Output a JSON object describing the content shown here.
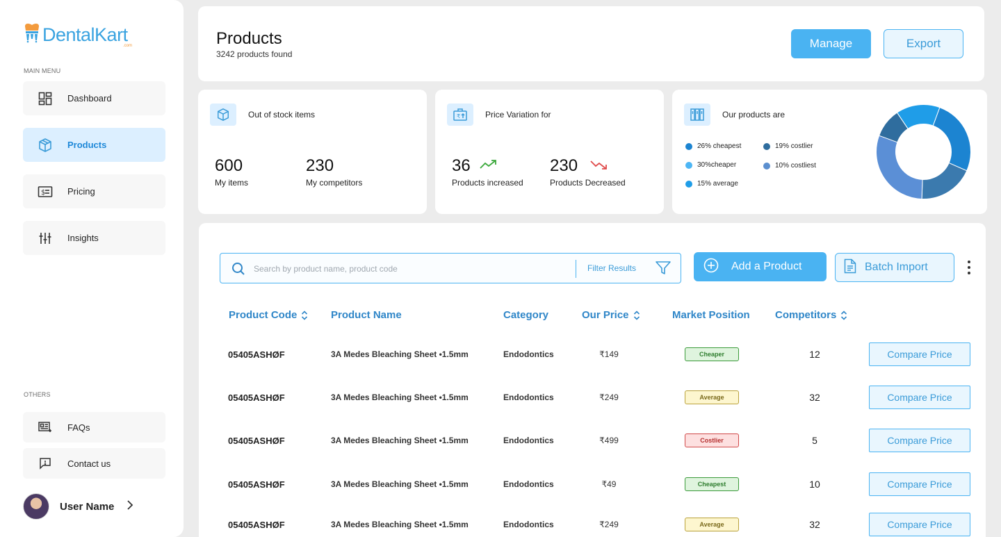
{
  "brand": {
    "name": "DentalKart",
    "sub": ".com"
  },
  "sidebar": {
    "main_menu_label": "MAIN MENU",
    "others_label": "OTHERS",
    "items": [
      {
        "label": "Dashboard",
        "icon": "dashboard-icon"
      },
      {
        "label": "Products",
        "icon": "cube-icon",
        "active": true
      },
      {
        "label": "Pricing",
        "icon": "price-tag-icon"
      },
      {
        "label": "Insights",
        "icon": "sliders-icon"
      }
    ],
    "others": [
      {
        "label": "FAQs",
        "icon": "faq-icon"
      },
      {
        "label": "Contact us",
        "icon": "chat-icon"
      }
    ],
    "user_name": "User Name"
  },
  "header": {
    "title": "Products",
    "subtitle": "3242 products found",
    "manage_label": "Manage",
    "export_label": "Export"
  },
  "stats": {
    "stock": {
      "title": "Out of stock items",
      "my_items_value": "600",
      "my_items_label": "My items",
      "competitors_value": "230",
      "competitors_label": "My competitors"
    },
    "variation": {
      "title": "Price Variation for",
      "increased_value": "36",
      "increased_label": "Products increased",
      "decreased_value": "230",
      "decreased_label": "Products Decreased"
    },
    "position": {
      "title": "Our products are",
      "legend": [
        {
          "label": "26% cheapest",
          "color": "#1c84d1"
        },
        {
          "label": "19% costlier",
          "color": "#2f6d9e"
        },
        {
          "label": "30%cheaper",
          "color": "#4db6f5"
        },
        {
          "label": "10% costliest",
          "color": "#5b8fcf"
        },
        {
          "label": "15% average",
          "color": "#1f9de8"
        }
      ]
    }
  },
  "chart_data": {
    "type": "pie",
    "title": "",
    "series": [
      {
        "name": "cheapest",
        "value": 26,
        "color": "#1c84d1"
      },
      {
        "name": "costlier",
        "value": 19,
        "color": "#3b7aae"
      },
      {
        "name": "cheaper",
        "value": 30,
        "color": "#5b8fd6"
      },
      {
        "name": "costliest",
        "value": 10,
        "color": "#2f6d9e"
      },
      {
        "name": "average",
        "value": 15,
        "color": "#1f9de8"
      }
    ]
  },
  "toolbar": {
    "search_placeholder": "Search by product name, product code",
    "filter_label": "Filter Results",
    "add_label": "Add a Product",
    "batch_label": "Batch Import"
  },
  "table": {
    "headers": {
      "code": "Product Code",
      "name": "Product Name",
      "category": "Category",
      "price": "Our Price",
      "position": "Market Position",
      "competitors": "Competitors"
    },
    "compare_label": "Compare Price",
    "rows": [
      {
        "code": "05405ASHØF",
        "name": "3A Medes Bleaching Sheet •1.5mm",
        "category": "Endodontics",
        "price": "₹149",
        "position": "Cheaper",
        "competitors": "12"
      },
      {
        "code": "05405ASHØF",
        "name": "3A Medes Bleaching Sheet •1.5mm",
        "category": "Endodontics",
        "price": "₹249",
        "position": "Average",
        "competitors": "32"
      },
      {
        "code": "05405ASHØF",
        "name": "3A Medes Bleaching Sheet •1.5mm",
        "category": "Endodontics",
        "price": "₹499",
        "position": "Costlier",
        "competitors": "5"
      },
      {
        "code": "05405ASHØF",
        "name": "3A Medes Bleaching Sheet •1.5mm",
        "category": "Endodontics",
        "price": "₹49",
        "position": "Cheapest",
        "competitors": "10"
      },
      {
        "code": "05405ASHØF",
        "name": "3A Medes Bleaching Sheet •1.5mm",
        "category": "Endodontics",
        "price": "₹249",
        "position": "Average",
        "competitors": "32"
      }
    ]
  },
  "badge_colors": {
    "Cheaper": {
      "bg": "#dff4de",
      "border": "#3a9a3a",
      "text": "#2e7d2e"
    },
    "Cheapest": {
      "bg": "#dff4de",
      "border": "#3a9a3a",
      "text": "#2e7d2e"
    },
    "Average": {
      "bg": "#fdf6cf",
      "border": "#b9a13a",
      "text": "#7a6a1c"
    },
    "Costlier": {
      "bg": "#fde0e0",
      "border": "#d04848",
      "text": "#b52f2f"
    }
  }
}
